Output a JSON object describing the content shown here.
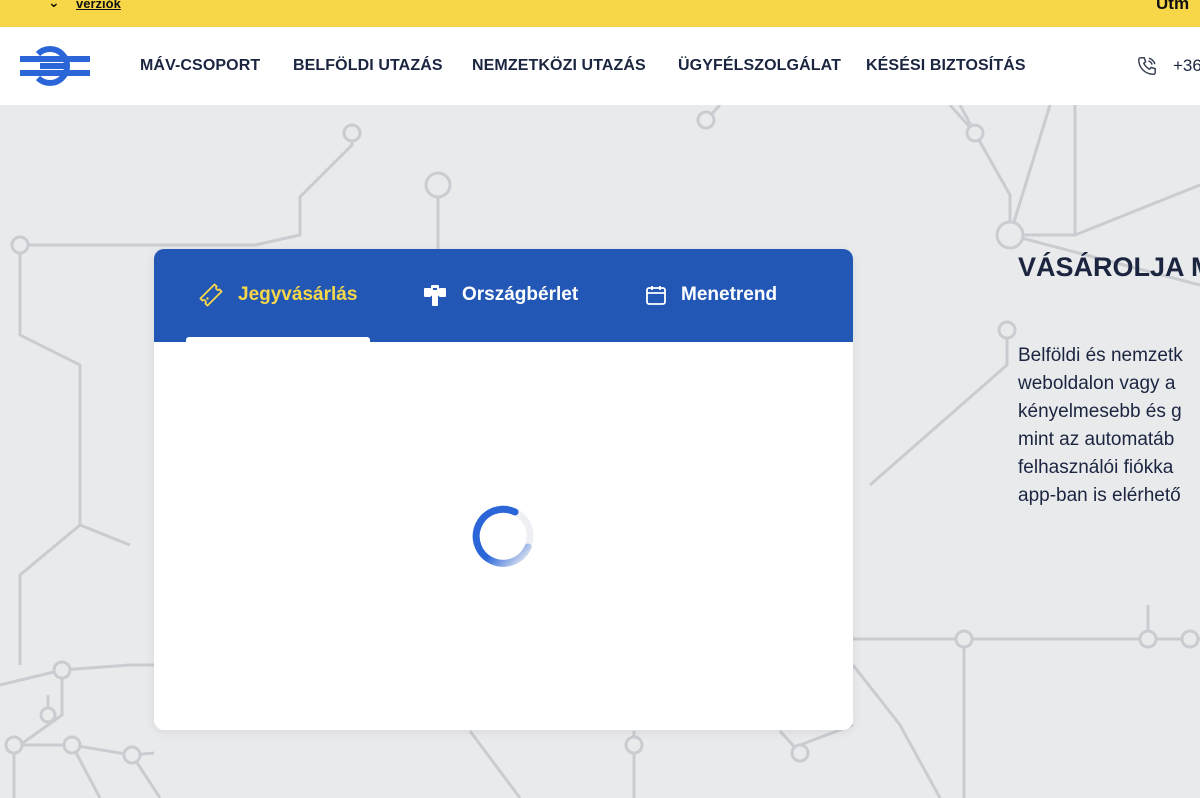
{
  "topbar": {
    "link": "verziók",
    "right_text": "Útm"
  },
  "header": {
    "nav": [
      {
        "label": "MÁV-CSOPORT"
      },
      {
        "label": "BELFÖLDI UTAZÁS"
      },
      {
        "label": "NEMZETKÖZI UTAZÁS"
      },
      {
        "label": "ÜGYFÉLSZOLGÁLAT"
      },
      {
        "label": "KÉSÉSI BIZTOSÍTÁS"
      }
    ],
    "phone": "+36"
  },
  "card": {
    "tabs": [
      {
        "label": "Jegyvásárlás",
        "icon": "ticket-icon",
        "active": true
      },
      {
        "label": "Országbérlet",
        "icon": "pass-icon",
        "active": false
      },
      {
        "label": "Menetrend",
        "icon": "calendar-icon",
        "active": false
      }
    ],
    "loading": true
  },
  "promo": {
    "title": "VÁSÁROLJA M",
    "lines": [
      "Belföldi és nemzetk",
      "weboldalon vagy a",
      "kényelmesebb és g",
      "mint az automatáb",
      "felhasználói fiókka",
      "app-ban is elérhető"
    ]
  },
  "colors": {
    "brand_blue": "#2357b6",
    "accent_yellow": "#f7d748",
    "background": "#e9eaec"
  }
}
